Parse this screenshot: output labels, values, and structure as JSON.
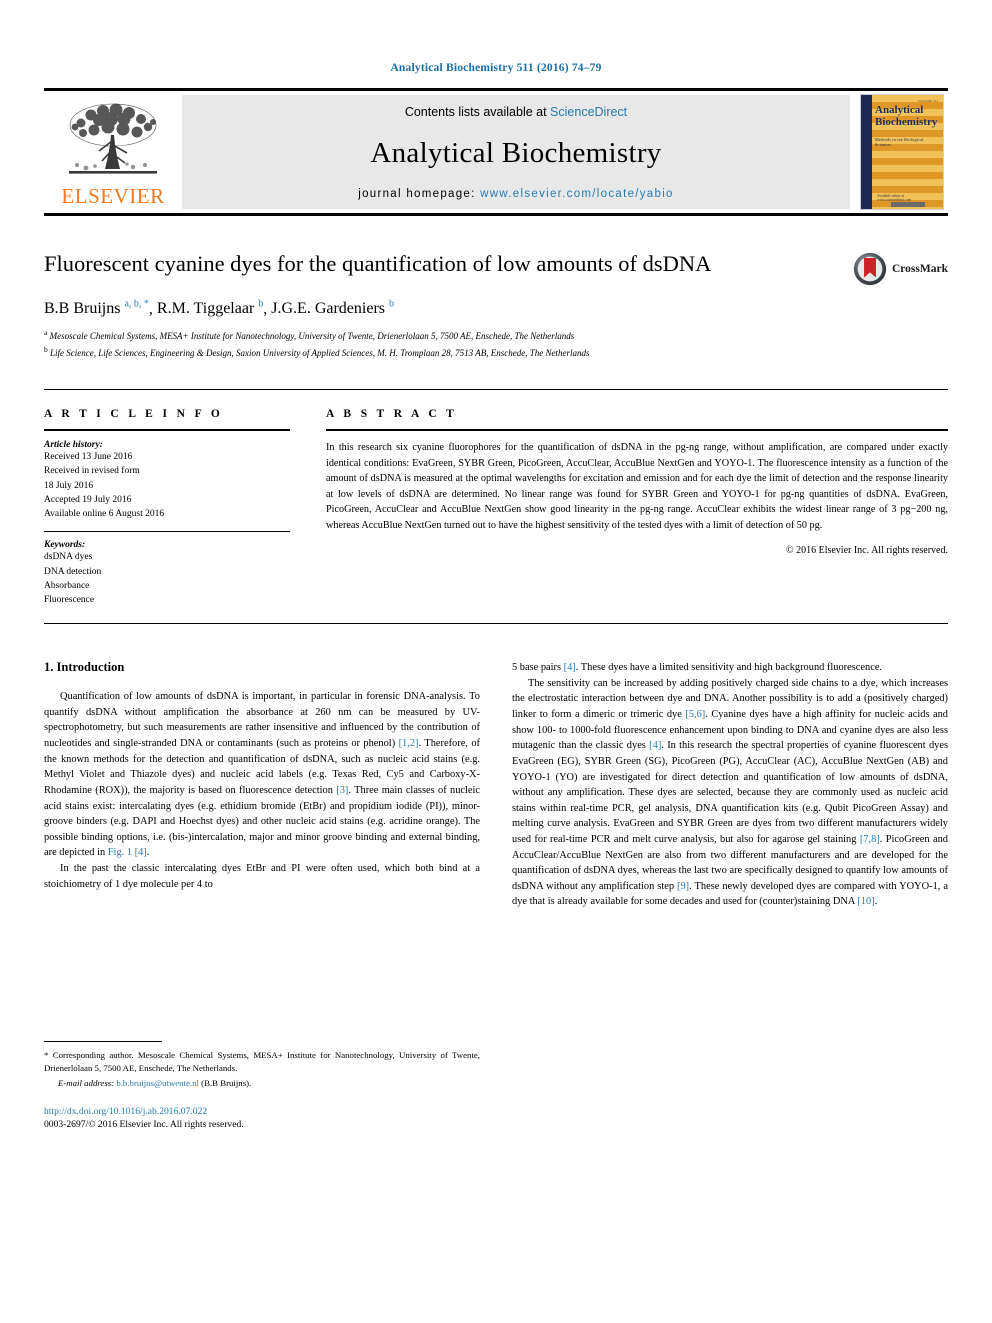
{
  "running_head": "Analytical Biochemistry 511 (2016) 74–79",
  "masthead": {
    "publisher_name": "ELSEVIER",
    "contents_prefix": "Contents lists available at ",
    "contents_link": "ScienceDirect",
    "journal_name": "Analytical Biochemistry",
    "homepage_prefix": "journal homepage: ",
    "homepage_url": "www.elsevier.com/locate/yabio",
    "cover": {
      "title_line1": "Analytical",
      "title_line2": "Biochemistry",
      "subtitle": "Methods in the Biological Sciences",
      "top_code": "VOLUME 511",
      "footer": "Available online at www.sciencedirect.com"
    }
  },
  "article": {
    "title": "Fluorescent cyanine dyes for the quantification of low amounts of dsDNA",
    "crossmark_label": "CrossMark",
    "authors": [
      {
        "name": "B.B Bruijns",
        "marks": "a, b, *"
      },
      {
        "name": "R.M. Tiggelaar",
        "marks": "b"
      },
      {
        "name": "J.G.E. Gardeniers",
        "marks": "b"
      }
    ],
    "affiliations": [
      {
        "mark": "a",
        "text": "Mesoscale Chemical Systems, MESA+ Institute for Nanotechnology, University of Twente, Drienerlolaan 5, 7500 AE, Enschede, The Netherlands"
      },
      {
        "mark": "b",
        "text": "Life Science, Life Sciences, Engineering & Design, Saxion University of Applied Sciences, M. H. Tromplaan 28, 7513 AB, Enschede, The Netherlands"
      }
    ]
  },
  "article_info": {
    "heading": "A R T I C L E  I N F O",
    "history_label": "Article history:",
    "history": [
      "Received 13 June 2016",
      "Received in revised form",
      "18 July 2016",
      "Accepted 19 July 2016",
      "Available online 6 August 2016"
    ],
    "keywords_label": "Keywords:",
    "keywords": [
      "dsDNA dyes",
      "DNA detection",
      "Absorbance",
      "Fluorescence"
    ]
  },
  "abstract": {
    "heading": "A B S T R A C T",
    "text": "In this research six cyanine fluorophores for the quantification of dsDNA in the pg-ng range, without amplification, are compared under exactly identical conditions: EvaGreen, SYBR Green, PicoGreen, AccuClear, AccuBlue NextGen and YOYO-1. The fluorescence intensity as a function of the amount of dsDNA is measured at the optimal wavelengths for excitation and emission and for each dye the limit of detection and the response linearity at low levels of dsDNA are determined. No linear range was found for SYBR Green and YOYO-1 for pg-ng quantities of dsDNA. EvaGreen, PicoGreen, AccuClear and AccuBlue NextGen show good linearity in the pg-ng range. AccuClear exhibits the widest linear range of 3 pg−200 ng, whereas AccuBlue NextGen turned out to have the highest sensitivity of the tested dyes with a limit of detection of 50 pg.",
    "copyright": "© 2016 Elsevier Inc. All rights reserved."
  },
  "introduction": {
    "section_title": "1. Introduction",
    "left_paragraphs": [
      "Quantification of low amounts of dsDNA is important, in particular in forensic DNA-analysis. To quantify dsDNA without amplification the absorbance at 260 nm can be measured by UV-spectrophotometry, but such measurements are rather insensitive and influenced by the contribution of nucleotides and single-stranded DNA or contaminants (such as proteins or phenol) [1,2]. Therefore, of the known methods for the detection and quantification of dsDNA, such as nucleic acid stains (e.g. Methyl Violet and Thiazole dyes) and nucleic acid labels (e.g. Texas Red, Cy5 and Carboxy-X-Rhodamine (ROX)), the majority is based on fluorescence detection [3]. Three main classes of nucleic acid stains exist: intercalating dyes (e.g. ethidium bromide (EtBr) and propidium iodide (PI)), minor-groove binders (e.g. DAPI and Hoechst dyes) and other nucleic acid stains (e.g. acridine orange). The possible binding options, i.e. (bis-)intercalation, major and minor groove binding and external binding, are depicted in Fig. 1 [4].",
      "In the past the classic intercalating dyes EtBr and PI were often used, which both bind at a stoichiometry of 1 dye molecule per 4 to"
    ],
    "right_paragraphs": [
      "5 base pairs [4]. These dyes have a limited sensitivity and high background fluorescence.",
      "The sensitivity can be increased by adding positively charged side chains to a dye, which increases the electrostatic interaction between dye and DNA. Another possibility is to add a (positively charged) linker to form a dimeric or trimeric dye [5,6]. Cyanine dyes have a high affinity for nucleic acids and show 100- to 1000-fold fluorescence enhancement upon binding to DNA and cyanine dyes are also less mutagenic than the classic dyes [4]. In this research the spectral properties of cyanine fluorescent dyes EvaGreen (EG), SYBR Green (SG), PicoGreen (PG), AccuClear (AC), AccuBlue NextGen (AB) and YOYO-1 (YO) are investigated for direct detection and quantification of low amounts of dsDNA, without any amplification. These dyes are selected, because they are commonly used as nucleic acid stains within real-time PCR, gel analysis, DNA quantification kits (e.g. Qubit PicoGreen Assay) and melting curve analysis. EvaGreen and SYBR Green are dyes from two different manufacturers widely used for real-time PCR and melt curve analysis, but also for agarose gel staining [7,8]. PicoGreen and AccuClear/AccuBlue NextGen are also from two different manufacturers and are developed for the quantification of dsDNA dyes, whereas the last two are specifically designed to quantify low amounts of dsDNA without any amplification step [9]. These newly developed dyes are compared with YOYO-1, a dye that is already available for some decades and used for (counter)staining DNA [10]."
    ]
  },
  "footnote": {
    "corresponding": "* Corresponding author. Mesoscale Chemical Systems, MESA+ Institute for Nanotechnology, University of Twente, Drienerlolaan 5, 7500 AE, Enschede, The Netherlands.",
    "email_label": "E-mail address:",
    "email": "b.b.bruijns@utwente.nl",
    "email_owner": "(B.B Bruijns).",
    "doi": "http://dx.doi.org/10.1016/j.ab.2016.07.022",
    "issn": "0003-2697/© 2016 Elsevier Inc. All rights reserved."
  },
  "colors": {
    "link_blue": "#2a7ab0",
    "elsevier_orange": "#F47920",
    "banner_gray": "#e8e8e8",
    "cover_navy": "#1b2a55"
  }
}
